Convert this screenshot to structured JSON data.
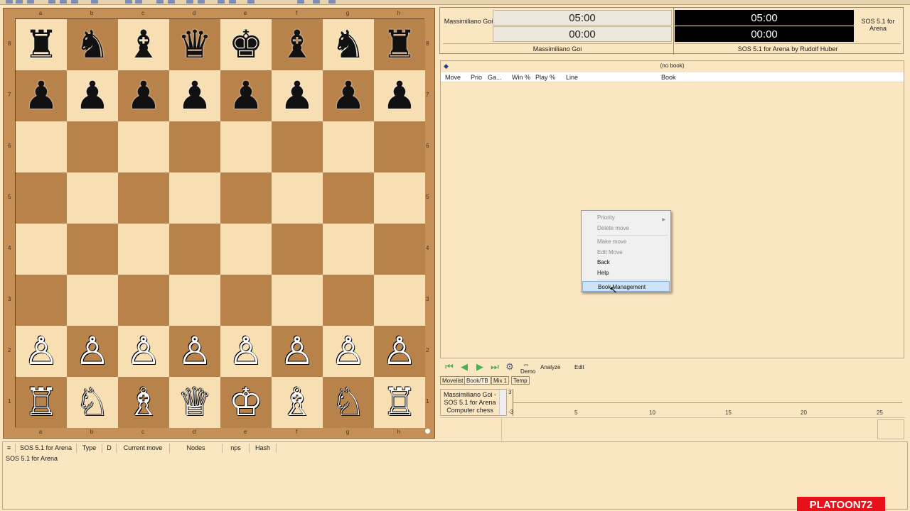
{
  "board": {
    "files": [
      "a",
      "b",
      "c",
      "d",
      "e",
      "f",
      "g",
      "h"
    ],
    "ranks": [
      "8",
      "7",
      "6",
      "5",
      "4",
      "3",
      "2",
      "1"
    ],
    "position": [
      [
        "bR",
        "bN",
        "bB",
        "bQ",
        "bK",
        "bB",
        "bN",
        "bR"
      ],
      [
        "bP",
        "bP",
        "bP",
        "bP",
        "bP",
        "bP",
        "bP",
        "bP"
      ],
      [
        "",
        "",
        "",
        "",
        "",
        "",
        "",
        ""
      ],
      [
        "",
        "",
        "",
        "",
        "",
        "",
        "",
        ""
      ],
      [
        "",
        "",
        "",
        "",
        "",
        "",
        "",
        ""
      ],
      [
        "",
        "",
        "",
        "",
        "",
        "",
        "",
        ""
      ],
      [
        "wP",
        "wP",
        "wP",
        "wP",
        "wP",
        "wP",
        "wP",
        "wP"
      ],
      [
        "wR",
        "wN",
        "wB",
        "wQ",
        "wK",
        "wB",
        "wN",
        "wR"
      ]
    ],
    "colors": {
      "light": "#f7dfb3",
      "dark": "#b8824b",
      "frame": "#c49057"
    }
  },
  "clocks": {
    "white_player_short": "Massimiliano Goi",
    "white_time_main": "05:00",
    "white_time_sub": "00:00",
    "white_player_full": "Massimiliano Goi",
    "black_player_short": "SOS 5.1 for Arena",
    "black_time_main": "05:00",
    "black_time_sub": "00:00",
    "black_player_full": "SOS 5.1 for Arena by Rudolf Huber"
  },
  "book": {
    "title": "(no book)",
    "icon": "book-icon",
    "columns": [
      "Move",
      "Prio",
      "Ga...",
      "Win %",
      "Play %",
      "Line",
      "Book"
    ]
  },
  "context_menu": {
    "items": [
      {
        "label": "Priority",
        "enabled": false,
        "submenu": true
      },
      {
        "label": "Delete move",
        "enabled": false
      },
      {
        "label": "Make move",
        "enabled": false
      },
      {
        "label": "Edit Move",
        "enabled": false
      },
      {
        "label": "Back",
        "enabled": true
      },
      {
        "label": "Help",
        "enabled": true
      },
      {
        "label": "Book Management",
        "enabled": true,
        "highlighted": true
      }
    ]
  },
  "nav": {
    "demo": "Demo",
    "analyze": "Analyze",
    "edit": "Edit"
  },
  "tabs": [
    "Movelist",
    "Book/TB",
    "Mix 1",
    "Temp"
  ],
  "moves": {
    "lines": [
      "Massimiliano Goi -",
      "SOS 5.1 for Arena",
      "Computer chess"
    ]
  },
  "graph": {
    "y_top": "3",
    "y_bottom": "-3",
    "x_ticks": [
      "5",
      "10",
      "15",
      "20",
      "25"
    ]
  },
  "engine": {
    "columns": [
      "SOS 5.1 for Arena",
      "Type",
      "D",
      "Current move",
      "Nodes",
      "nps",
      "Hash"
    ],
    "name_line": "SOS 5.1 for Arena"
  },
  "watermark": "PLATOON72"
}
